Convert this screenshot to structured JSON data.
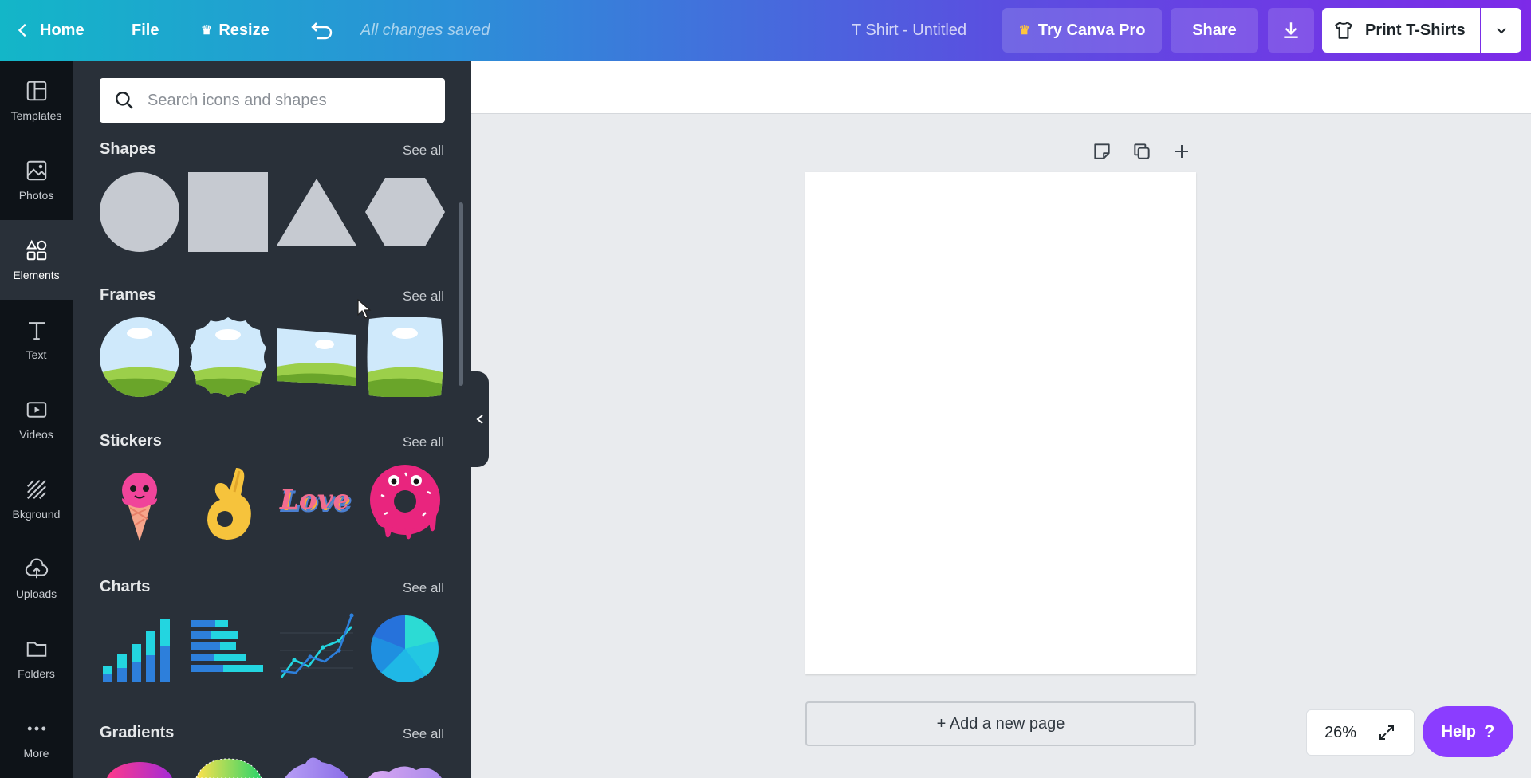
{
  "topbar": {
    "home": "Home",
    "file": "File",
    "resize": "Resize",
    "saved_status": "All changes saved",
    "doc_title": "T Shirt - Untitled",
    "try_pro": "Try Canva Pro",
    "share": "Share",
    "print": "Print T-Shirts"
  },
  "nav": {
    "items": [
      {
        "label": "Templates",
        "icon": "templates-icon"
      },
      {
        "label": "Photos",
        "icon": "photos-icon"
      },
      {
        "label": "Elements",
        "icon": "elements-icon"
      },
      {
        "label": "Text",
        "icon": "text-icon"
      },
      {
        "label": "Videos",
        "icon": "videos-icon"
      },
      {
        "label": "Bkground",
        "icon": "background-icon"
      },
      {
        "label": "Uploads",
        "icon": "uploads-icon"
      },
      {
        "label": "Folders",
        "icon": "folders-icon"
      },
      {
        "label": "More",
        "icon": "more-icon"
      }
    ],
    "active": "Elements"
  },
  "panel": {
    "search_placeholder": "Search icons and shapes",
    "sections": [
      {
        "title": "Shapes",
        "see_all": "See all"
      },
      {
        "title": "Frames",
        "see_all": "See all"
      },
      {
        "title": "Stickers",
        "see_all": "See all"
      },
      {
        "title": "Charts",
        "see_all": "See all"
      },
      {
        "title": "Gradients",
        "see_all": "See all"
      }
    ]
  },
  "canvas": {
    "add_page": "+ Add a new page",
    "zoom": "26%",
    "help": "Help",
    "help_icon": "?"
  },
  "colors": {
    "accent": "#8b3dff",
    "panel_bg": "#293039",
    "nav_bg": "#0e1318"
  }
}
